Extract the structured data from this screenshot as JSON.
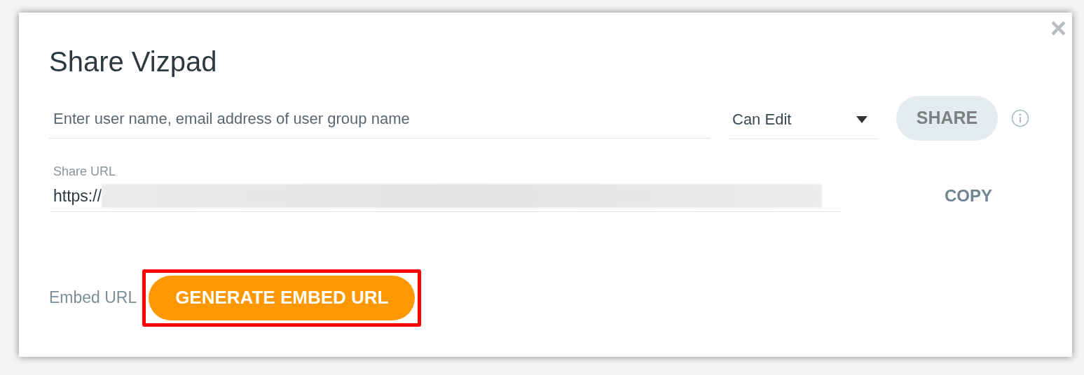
{
  "dialog": {
    "title": "Share Vizpad",
    "close": "×"
  },
  "invite": {
    "placeholder": "Enter user name, email address of user group name",
    "permission": "Can Edit",
    "share_button": {
      "label": "SHARE",
      "disabled": true
    }
  },
  "share_url": {
    "label": "Share URL",
    "value": "https://",
    "redacted": true,
    "copy": "COPY"
  },
  "embed": {
    "label": "Embed URL",
    "button": "GENERATE EMBED URL",
    "highlighted": true
  }
}
